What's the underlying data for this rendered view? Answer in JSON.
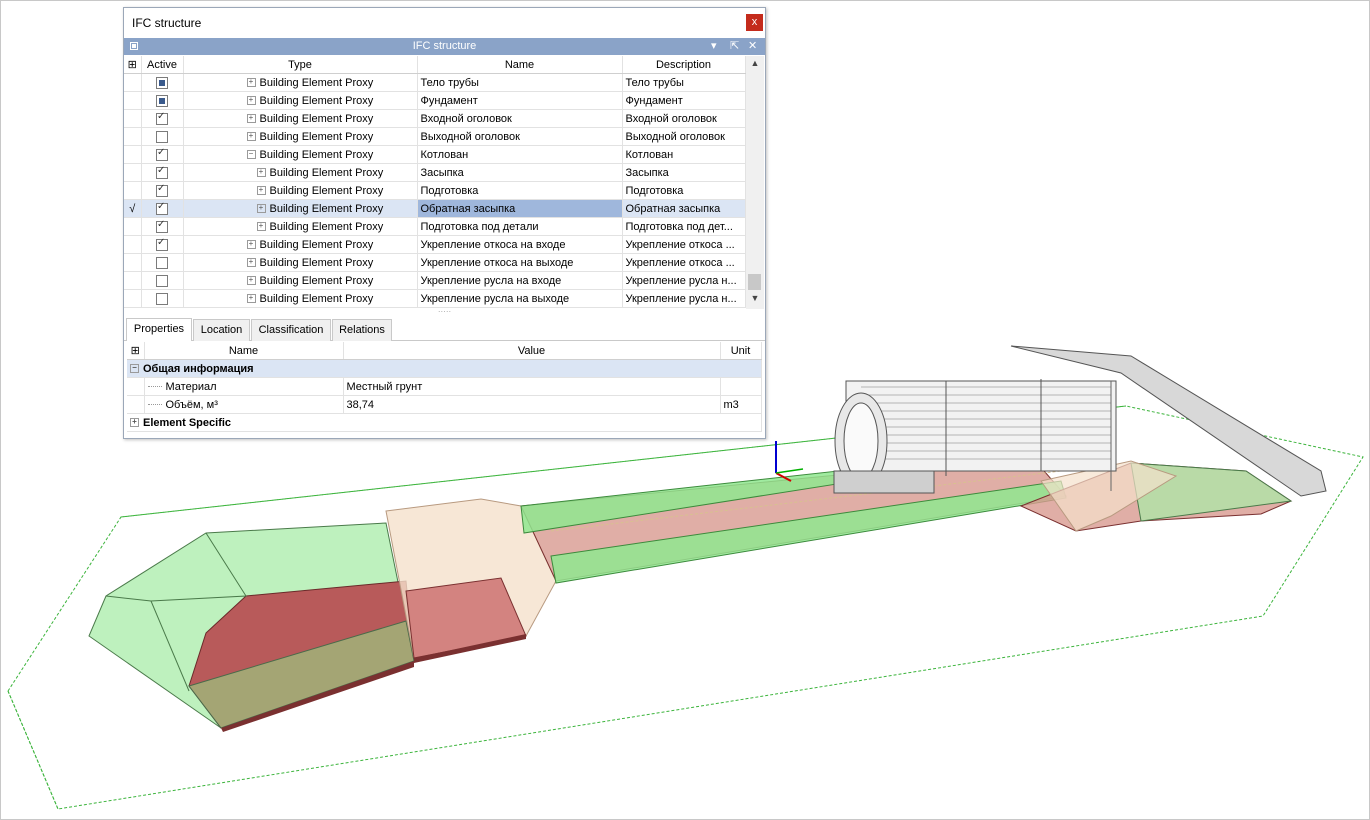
{
  "window": {
    "title": "IFC structure",
    "close_label": "x"
  },
  "panel": {
    "title": "IFC structure",
    "menu_label": "▾",
    "float_label": "⇱",
    "close_label": "✕"
  },
  "tree": {
    "columns": {
      "active": "Active",
      "type": "Type",
      "name": "Name",
      "description": "Description"
    },
    "rows": [
      {
        "active": "partial",
        "level": 1,
        "expander": "+",
        "type": "Building Element Proxy",
        "name": "Тело трубы",
        "description": "Тело трубы"
      },
      {
        "active": "partial",
        "level": 1,
        "expander": "+",
        "type": "Building Element Proxy",
        "name": "Фундамент",
        "description": "Фундамент"
      },
      {
        "active": "checked",
        "level": 1,
        "expander": "+",
        "type": "Building Element Proxy",
        "name": "Входной оголовок",
        "description": "Входной оголовок"
      },
      {
        "active": "unchecked",
        "level": 1,
        "expander": "+",
        "type": "Building Element Proxy",
        "name": "Выходной оголовок",
        "description": "Выходной оголовок"
      },
      {
        "active": "checked",
        "level": 1,
        "expander": "−",
        "type": "Building Element Proxy",
        "name": "Котлован",
        "description": "Котлован"
      },
      {
        "active": "checked",
        "level": 2,
        "expander": "+",
        "type": "Building Element Proxy",
        "name": "Засыпка",
        "description": "Засыпка"
      },
      {
        "active": "checked",
        "level": 2,
        "expander": "+",
        "type": "Building Element Proxy",
        "name": "Подготовка",
        "description": "Подготовка"
      },
      {
        "active": "checked",
        "level": 2,
        "expander": "+",
        "type": "Building Element Proxy",
        "name": "Обратная засыпка",
        "description": "Обратная засыпка",
        "selected": true,
        "marker": "√"
      },
      {
        "active": "checked",
        "level": 2,
        "expander": "+",
        "type": "Building Element Proxy",
        "name": "Подготовка под детали",
        "description": "Подготовка под дет..."
      },
      {
        "active": "checked",
        "level": 1,
        "expander": "+",
        "type": "Building Element Proxy",
        "name": "Укрепление откоса на входе",
        "description": "Укрепление откоса ..."
      },
      {
        "active": "unchecked",
        "level": 1,
        "expander": "+",
        "type": "Building Element Proxy",
        "name": "Укрепление откоса на выходе",
        "description": "Укрепление откоса ..."
      },
      {
        "active": "unchecked",
        "level": 1,
        "expander": "+",
        "type": "Building Element Proxy",
        "name": "Укрепление русла на входе",
        "description": "Укрепление русла н..."
      },
      {
        "active": "unchecked",
        "level": 1,
        "expander": "+",
        "type": "Building Element Proxy",
        "name": "Укрепление русла на выходе",
        "description": "Укрепление русла н..."
      }
    ]
  },
  "tabs": [
    {
      "label": "Properties",
      "active": true
    },
    {
      "label": "Location",
      "active": false
    },
    {
      "label": "Classification",
      "active": false
    },
    {
      "label": "Relations",
      "active": false
    }
  ],
  "properties": {
    "columns": {
      "name": "Name",
      "value": "Value",
      "unit": "Unit"
    },
    "group1": {
      "expander": "−",
      "label": "Общая информация"
    },
    "rows": [
      {
        "name": "Материал",
        "value": "Местный грунт",
        "unit": ""
      },
      {
        "name": "Объём, м³",
        "value": "38,74",
        "unit": "m3"
      }
    ],
    "group2": {
      "expander": "+",
      "label": "Element Specific"
    }
  },
  "colors": {
    "panel_header": "#8aa3c8",
    "selection": "#9fb7dc",
    "close_button": "#c42b1c",
    "green_fill": "#7fe07f",
    "red_fill": "#b85555"
  }
}
